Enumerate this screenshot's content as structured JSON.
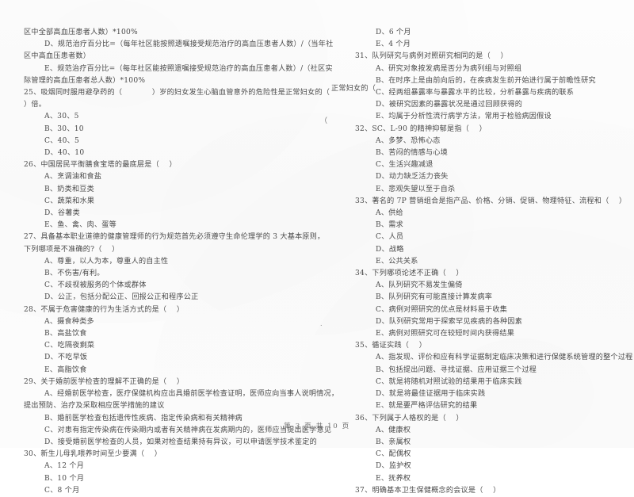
{
  "document": {
    "type": "scanned-exam-paper",
    "footer": "第 3 页 共 10 页",
    "page_number": 3,
    "total_pages": 10,
    "ink_color": "#4a4a4a",
    "paper_color": "#fdfdfd"
  },
  "left_column": {
    "lines": [
      {
        "kind": "cont",
        "text": "区中全部高血压患者人数）*100%"
      },
      {
        "kind": "opt",
        "text": "D、规范治疗百分比=（每年社区能按照遗嘱接受规范治疗的高血压患者人数）/（当年社"
      },
      {
        "kind": "cont",
        "text": "区中高血压患者数）"
      },
      {
        "kind": "opt",
        "text": "E、规范治疗百分比=（每年社区能按照遗嘱接受规范治疗的高血压患者人数）/（社区实"
      },
      {
        "kind": "cont",
        "text": "际管理的高血压患者总人数）*100%"
      },
      {
        "kind": "q",
        "text": "25、吸烟同时服用避孕药的（            ）岁的妇女发生心脑血管意外的危险性是正常妇女的（"
      },
      {
        "kind": "cont",
        "text": "）倍。"
      },
      {
        "kind": "opt",
        "text": "A、30、5"
      },
      {
        "kind": "opt",
        "text": "B、30、10"
      },
      {
        "kind": "opt",
        "text": "C、40、5"
      },
      {
        "kind": "opt",
        "text": "D、40、10"
      },
      {
        "kind": "q",
        "text": "26、中国居民平衡膳食宝塔的最底层是（    ）"
      },
      {
        "kind": "opt",
        "text": "A、烹调油和食盐"
      },
      {
        "kind": "opt",
        "text": "B、奶类和豆类"
      },
      {
        "kind": "opt",
        "text": "C、蔬菜和水果"
      },
      {
        "kind": "opt",
        "text": "D、谷薯类"
      },
      {
        "kind": "opt",
        "text": "E、鱼、禽、肉、蛋等"
      },
      {
        "kind": "q",
        "text": "27、具备基本职业道德的健康管理师的行为规范首先必须遵守生命伦理学的 3 大基本原则，"
      },
      {
        "kind": "cont",
        "text": "下列哪项是不准确的?（    ）"
      },
      {
        "kind": "opt",
        "text": "A、尊重，以人为本，尊重人的自主性"
      },
      {
        "kind": "opt",
        "text": "B、不伤害/有利。"
      },
      {
        "kind": "opt",
        "text": "C、不歧视被服务的个体或群体"
      },
      {
        "kind": "opt",
        "text": "D、公正，包括分配公正、回报公正和程序公正"
      },
      {
        "kind": "q",
        "text": "28、不属于危害健康的行为生活方式的是（    ）"
      },
      {
        "kind": "opt",
        "text": "A、摄食种类多"
      },
      {
        "kind": "opt",
        "text": "B、高盐饮食"
      },
      {
        "kind": "opt",
        "text": "C、吃隔夜剩菜"
      },
      {
        "kind": "opt",
        "text": "D、不吃早饭"
      },
      {
        "kind": "opt",
        "text": "E、高脂饮食"
      },
      {
        "kind": "q",
        "text": "29、关于婚前医学检查的理解不正确的是（    ）"
      },
      {
        "kind": "opt",
        "text": "A、经婚前医学检查，医疗保健机构应出具婚前医学检查证明，医师应向当事人说明情况，"
      },
      {
        "kind": "cont",
        "text": "提出预防、治疗及采取相应医学措施的建议"
      },
      {
        "kind": "opt",
        "text": "B、婚前医学检查包括遗传性疾病、指定传染病和有关精神病"
      },
      {
        "kind": "opt",
        "text": "C、对患有指定传染病在传染期内或者有关精神病在发病期内的，医师应当提出医学意见"
      },
      {
        "kind": "opt",
        "text": "D、接受婚前医学检查的人员，如果对检查结果持有异议，可以申请医学技术鉴定的"
      },
      {
        "kind": "q",
        "text": "30、新生儿母乳喂养时间至少要满（    ）"
      },
      {
        "kind": "opt",
        "text": "A、12 个月"
      },
      {
        "kind": "opt",
        "text": "B、10 个月"
      },
      {
        "kind": "opt",
        "text": "C、8 个月"
      }
    ]
  },
  "right_column": {
    "lines": [
      {
        "kind": "opt",
        "text": "D、6 个月"
      },
      {
        "kind": "opt",
        "text": "E、4 个月"
      },
      {
        "kind": "q",
        "text": "31、队列研究与病例对照研究相同的是（    ）"
      },
      {
        "kind": "opt",
        "text": "A、研究对象按发病是否分为病列组与对照组"
      },
      {
        "kind": "opt",
        "text": "B、在时序上是由前向后的，在疾病发生前开始进行属于前瞻性研究"
      },
      {
        "kind": "opt",
        "text": "C、经两组暴露率与暴露水平的比较，分析暴露与疾病的联系"
      },
      {
        "kind": "opt",
        "text": "D、被研究因素的暴露状况是通过回顾获得的"
      },
      {
        "kind": "opt",
        "text": "E、均属于分析性流行病学方法，常用于检验病因假设"
      },
      {
        "kind": "q",
        "text": "32、SC、L-90 的精神抑郁是指（    ）"
      },
      {
        "kind": "opt",
        "text": "A、多梦、恐怖心态"
      },
      {
        "kind": "opt",
        "text": "B、苦闷的情感与心境"
      },
      {
        "kind": "opt",
        "text": "C、生活兴趣减退"
      },
      {
        "kind": "opt",
        "text": "D、动力缺乏活力丧失"
      },
      {
        "kind": "opt",
        "text": "E、悲观失望以至于自杀"
      },
      {
        "kind": "q",
        "text": "33、著名的 7P 营销组合是指产品、价格、分销、促销、物理特征、流程和（    ）"
      },
      {
        "kind": "opt",
        "text": "A、供给"
      },
      {
        "kind": "opt",
        "text": "B、需求"
      },
      {
        "kind": "opt",
        "text": "C、人员"
      },
      {
        "kind": "opt",
        "text": "D、战略"
      },
      {
        "kind": "opt",
        "text": "E、公共关系"
      },
      {
        "kind": "q",
        "text": "34、下列哪项论述不正确（    ）"
      },
      {
        "kind": "opt",
        "text": "A、队列研究不易发生偏倚"
      },
      {
        "kind": "opt",
        "text": "B、队列研究有可能直接计算发病率"
      },
      {
        "kind": "opt",
        "text": "C、病例对照研究的优点是材料易于收集"
      },
      {
        "kind": "opt",
        "text": "D、队列研究常用于探索罕见疾病的各种因素"
      },
      {
        "kind": "opt",
        "text": "E、病例对照研究可在较短时间内获得结果"
      },
      {
        "kind": "q",
        "text": "35、循证实践（    ）"
      },
      {
        "kind": "opt",
        "text": "A、指发现、评价和应有科学证据制定临床决策和进行保健系统管理的整个过程"
      },
      {
        "kind": "opt",
        "text": "B、包括提出问题、寻找证据、应用证据三个过程"
      },
      {
        "kind": "opt",
        "text": "C、就是将随机对照试验的结果用于临床实践"
      },
      {
        "kind": "opt",
        "text": "D、就是将最佳证据用于临床实践"
      },
      {
        "kind": "opt",
        "text": "E、就是要严格评估研究的结果"
      },
      {
        "kind": "q",
        "text": "36、下列属于人格权的是（    ）"
      },
      {
        "kind": "opt",
        "text": "A、健康权"
      },
      {
        "kind": "opt",
        "text": "B、亲属权"
      },
      {
        "kind": "opt",
        "text": "C、配偶权"
      },
      {
        "kind": "opt",
        "text": "D、监护权"
      },
      {
        "kind": "opt",
        "text": "E、抚养权"
      },
      {
        "kind": "q",
        "text": "37、明确基本卫生保健概念的会议是（    ）"
      }
    ]
  },
  "overflow": {
    "question25_tail": "正常妇女的（",
    "stray_paren": "（",
    "stray_mark": "."
  }
}
